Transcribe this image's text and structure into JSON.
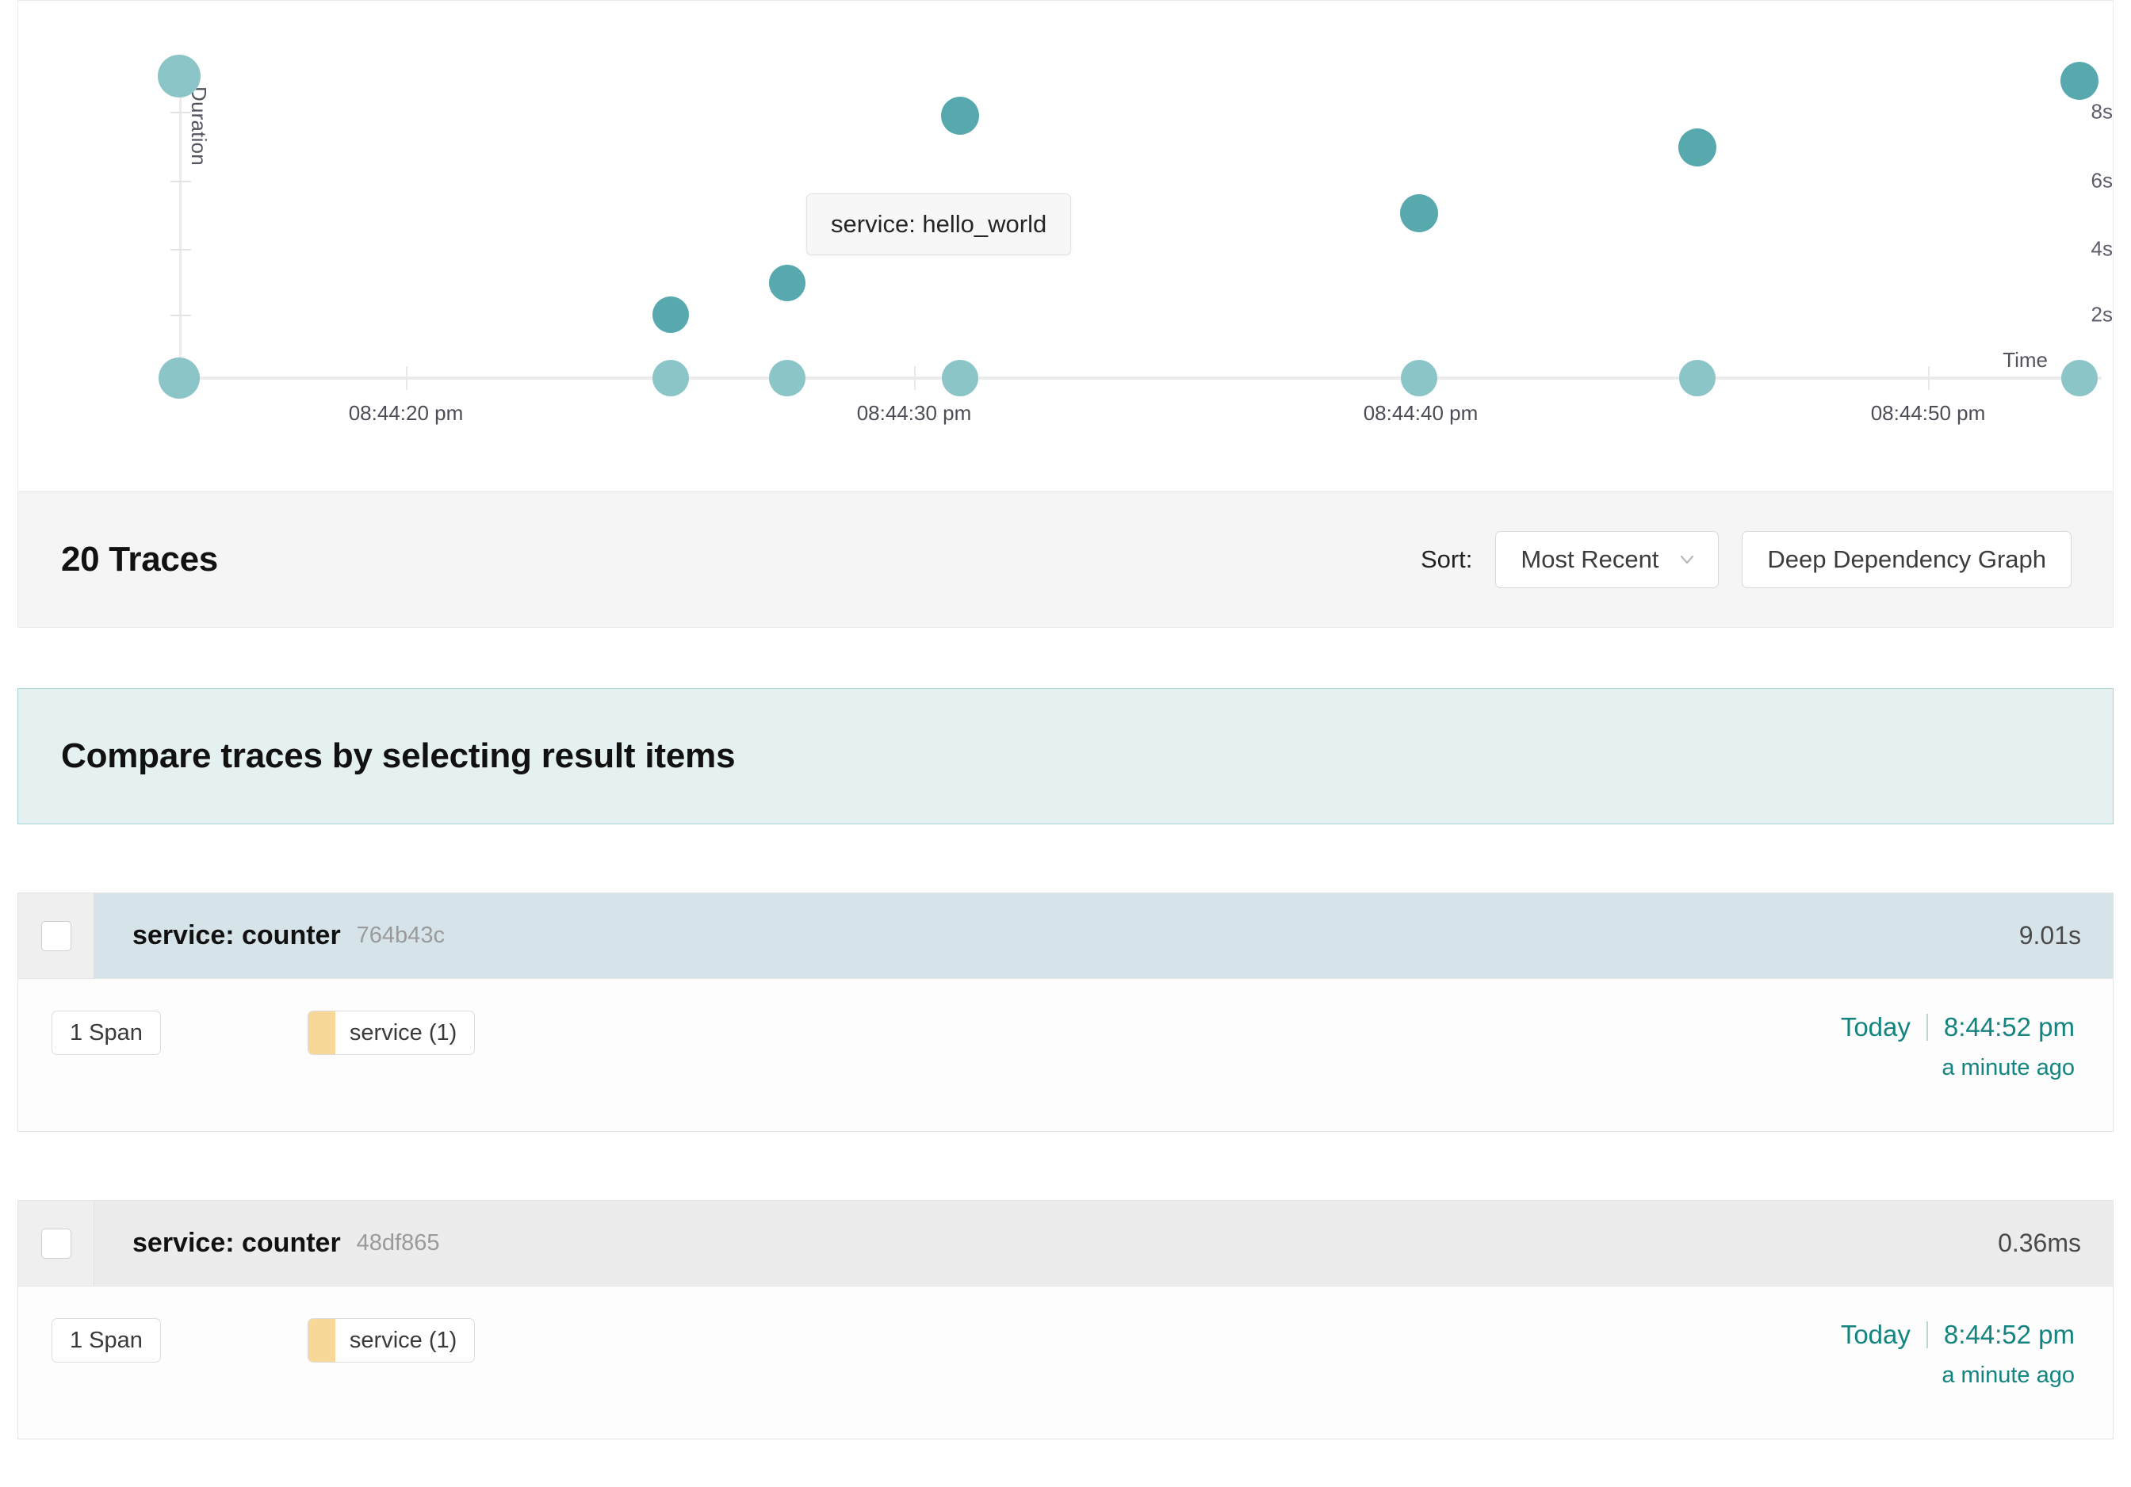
{
  "chart_data": {
    "type": "scatter",
    "title": "",
    "xlabel": "Time",
    "ylabel": "Duration",
    "grid": false,
    "legend": "none",
    "xticks": [
      "08:44:20 pm",
      "08:44:30 pm",
      "08:44:40 pm",
      "08:44:50 pm"
    ],
    "yticks": [
      "2s",
      "4s",
      "6s",
      "8s"
    ],
    "ylim": [
      0,
      9.5
    ],
    "points": [
      {
        "x": "08:44:13 pm",
        "y": 9.01,
        "size": "large",
        "shade": "light"
      },
      {
        "x": "08:44:13 pm",
        "y": 0.0,
        "size": "large",
        "shade": "light"
      },
      {
        "x": "08:44:26 pm",
        "y": 1.9,
        "size": "medium",
        "shade": "dark"
      },
      {
        "x": "08:44:26 pm",
        "y": 0.0,
        "size": "medium",
        "shade": "light"
      },
      {
        "x": "08:44:29 pm",
        "y": 3.1,
        "size": "medium",
        "shade": "dark"
      },
      {
        "x": "08:44:29 pm",
        "y": 0.0,
        "size": "medium",
        "shade": "light"
      },
      {
        "x": "08:44:32 pm",
        "y": 8.0,
        "size": "medium",
        "shade": "dark"
      },
      {
        "x": "08:44:32 pm",
        "y": 0.0,
        "size": "medium",
        "shade": "light"
      },
      {
        "x": "08:44:41 pm",
        "y": 5.1,
        "size": "medium",
        "shade": "dark"
      },
      {
        "x": "08:44:41 pm",
        "y": 0.0,
        "size": "medium",
        "shade": "light"
      },
      {
        "x": "08:44:47 pm",
        "y": 7.0,
        "size": "medium",
        "shade": "dark"
      },
      {
        "x": "08:44:47 pm",
        "y": 0.0,
        "size": "medium",
        "shade": "light"
      },
      {
        "x": "08:44:54 pm",
        "y": 9.01,
        "size": "medium",
        "shade": "dark"
      },
      {
        "x": "08:44:54 pm",
        "y": 0.0,
        "size": "medium",
        "shade": "light"
      }
    ],
    "tooltip": "service: hello_world",
    "colors": {
      "dot_light": "#8cc5c8",
      "dot_dark": "#57a9ae",
      "axis": "#ececec"
    }
  },
  "results": {
    "count_label": "20 Traces",
    "sort_label": "Sort:",
    "sort_value": "Most Recent",
    "deep_dependency_graph_label": "Deep Dependency Graph"
  },
  "compare_banner": {
    "text": "Compare traces by selecting result items",
    "accent": "#a9d4d4",
    "background": "#e5f0f0"
  },
  "traces": [
    {
      "title": "service: counter",
      "id": "764b43c",
      "duration": "9.01s",
      "spans": "1 Span",
      "service_pill": "service (1)",
      "service_color": "#f7d898",
      "day": "Today",
      "time": "8:44:52 pm",
      "relative": "a minute ago",
      "selected": true
    },
    {
      "title": "service: counter",
      "id": "48df865",
      "duration": "0.36ms",
      "spans": "1 Span",
      "service_pill": "service (1)",
      "service_color": "#f7d898",
      "day": "Today",
      "time": "8:44:52 pm",
      "relative": "a minute ago",
      "selected": false
    }
  ]
}
